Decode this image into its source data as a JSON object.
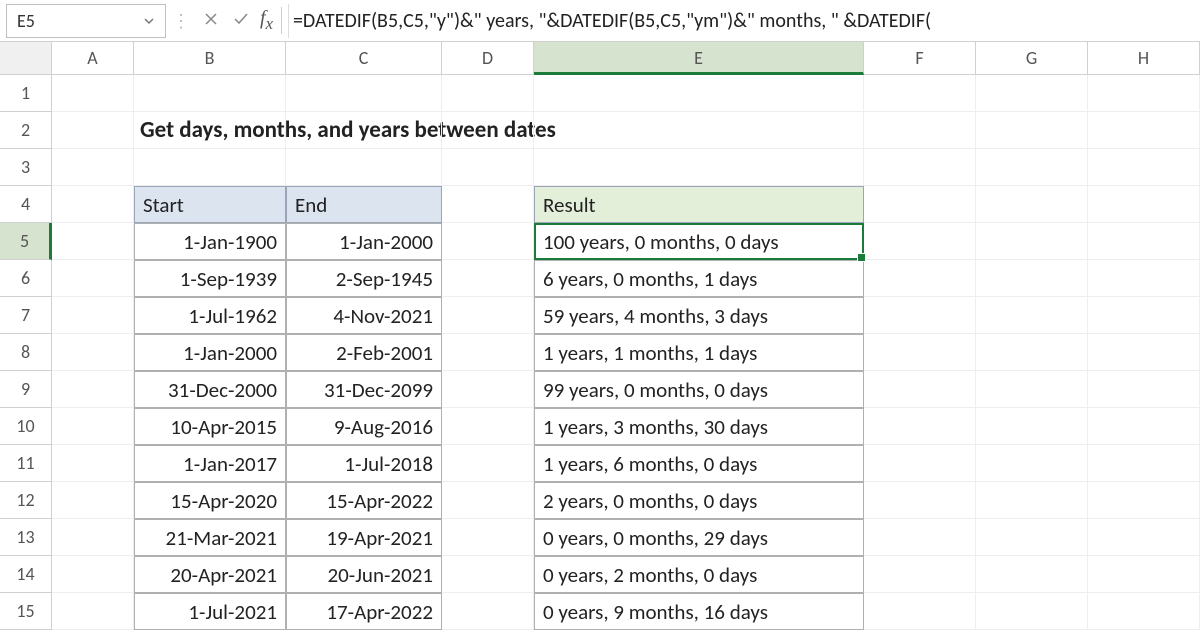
{
  "namebox": {
    "value": "E5"
  },
  "formula": "=DATEDIF(B5,C5,\"y\")&\" years, \"&DATEDIF(B5,C5,\"ym\")&\" months, \" &DATEDIF(",
  "columns": [
    "A",
    "B",
    "C",
    "D",
    "E",
    "F",
    "G",
    "H"
  ],
  "rownums": [
    "1",
    "2",
    "3",
    "4",
    "5",
    "6",
    "7",
    "8",
    "9",
    "10",
    "11",
    "12",
    "13",
    "14",
    "15"
  ],
  "title": "Get days, months, and years between dates",
  "headers": {
    "start": "Start",
    "end": "End",
    "result": "Result"
  },
  "rows": [
    {
      "start": "1-Jan-1900",
      "end": "1-Jan-2000",
      "result": "100 years, 0 months, 0 days"
    },
    {
      "start": "1-Sep-1939",
      "end": "2-Sep-1945",
      "result": "6 years, 0 months, 1 days"
    },
    {
      "start": "1-Jul-1962",
      "end": "4-Nov-2021",
      "result": "59 years, 4 months, 3 days"
    },
    {
      "start": "1-Jan-2000",
      "end": "2-Feb-2001",
      "result": "1 years, 1 months, 1 days"
    },
    {
      "start": "31-Dec-2000",
      "end": "31-Dec-2099",
      "result": "99 years, 0 months, 0 days"
    },
    {
      "start": "10-Apr-2015",
      "end": "9-Aug-2016",
      "result": "1 years, 3 months, 30 days"
    },
    {
      "start": "1-Jan-2017",
      "end": "1-Jul-2018",
      "result": "1 years, 6 months, 0 days"
    },
    {
      "start": "15-Apr-2020",
      "end": "15-Apr-2022",
      "result": "2 years, 0 months, 0 days"
    },
    {
      "start": "21-Mar-2021",
      "end": "19-Apr-2021",
      "result": "0 years, 0 months, 29 days"
    },
    {
      "start": "20-Apr-2021",
      "end": "20-Jun-2021",
      "result": "0 years, 2 months, 0 days"
    },
    {
      "start": "1-Jul-2021",
      "end": "17-Apr-2022",
      "result": "0 years, 9 months, 16 days"
    }
  ],
  "selected": {
    "col": "E",
    "row": "5"
  }
}
